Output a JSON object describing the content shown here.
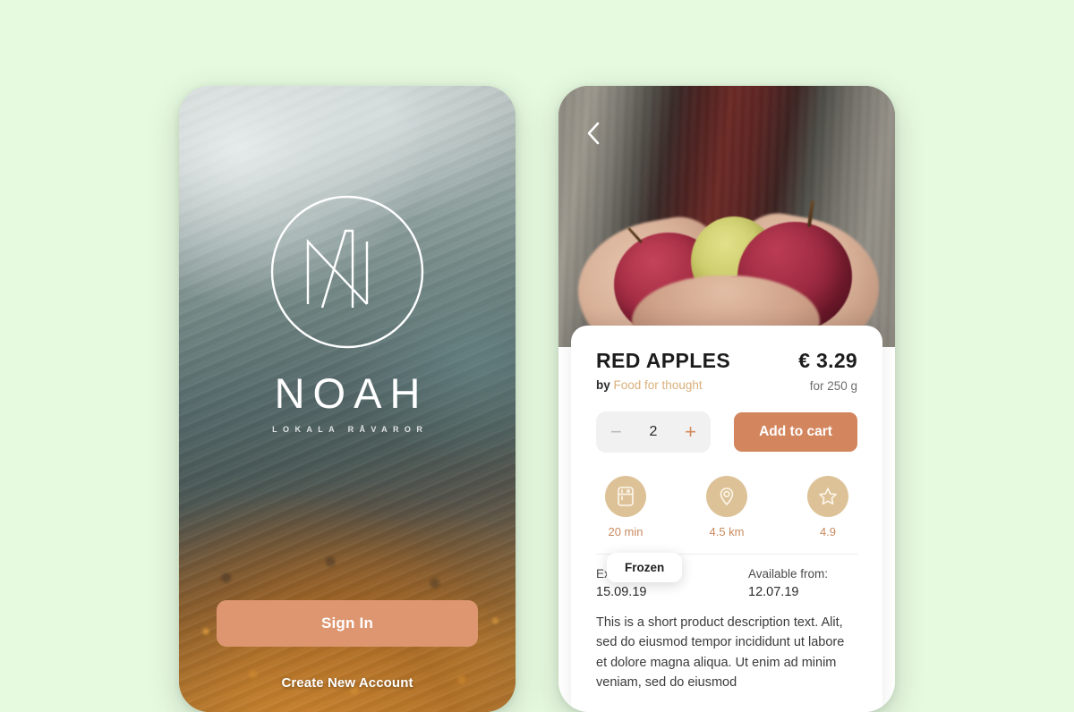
{
  "page": {
    "background_color": "#e6fae0"
  },
  "login_screen": {
    "logo_icon": "noah-monogram-icon",
    "brand_name": "NOAH",
    "tagline": "LOKALA RÅVAROR",
    "sign_in_label": "Sign In",
    "create_account_label": "Create New Account",
    "accent_color": "#dd9670"
  },
  "product_screen": {
    "back_icon": "chevron-left-icon",
    "hero_image_alt": "hands-holding-apples",
    "title": "RED APPLES",
    "by_prefix": "by",
    "vendor": "Food for thought",
    "price": "€ 3.29",
    "price_unit": "for 250 g",
    "quantity": "2",
    "decrement_label": "−",
    "increment_label": "+",
    "add_to_cart_label": "Add to cart",
    "accent_color": "#d3865e",
    "vendor_color": "#d9b07b",
    "meta": [
      {
        "icon": "fridge-icon",
        "label": "20 min"
      },
      {
        "icon": "location-pin-icon",
        "label": "4.5 km"
      },
      {
        "icon": "star-icon",
        "label": "4.9"
      }
    ],
    "tooltip": "Frozen",
    "dates": [
      {
        "label": "Expires:",
        "value": "15.09.19"
      },
      {
        "label": "Available from:",
        "value": "12.07.19"
      }
    ],
    "description": "This is a short product description text. Alit, sed do eiusmod tempor incididunt ut labore et dolore magna aliqua. Ut enim ad minim veniam, sed do eiusmod"
  }
}
